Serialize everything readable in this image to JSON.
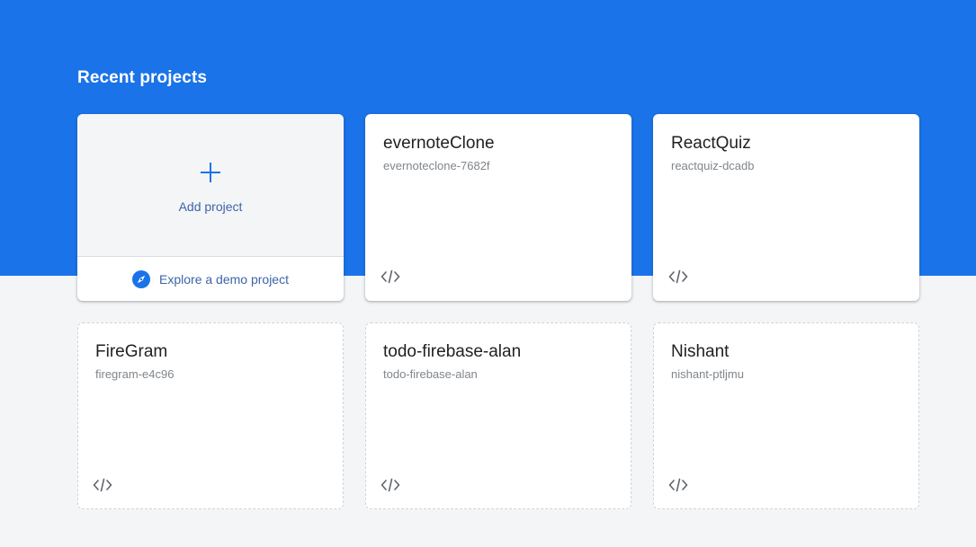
{
  "header": {
    "title": "Recent projects"
  },
  "add_card": {
    "add_label": "Add project",
    "demo_label": "Explore a demo project",
    "plus_icon": "plus-icon",
    "demo_icon": "compass-icon"
  },
  "projects": [
    {
      "name": "evernoteClone",
      "id": "evernoteclone-7682f",
      "icon": "code-icon"
    },
    {
      "name": "ReactQuiz",
      "id": "reactquiz-dcadb",
      "icon": "code-icon"
    },
    {
      "name": "FireGram",
      "id": "firegram-e4c96",
      "icon": "code-icon"
    },
    {
      "name": "todo-firebase-alan",
      "id": "todo-firebase-alan",
      "icon": "code-icon"
    },
    {
      "name": "Nishant",
      "id": "nishant-ptljmu",
      "icon": "code-icon"
    }
  ],
  "colors": {
    "band": "#1a73e8",
    "page_background": "#f4f5f7",
    "accent_text": "#3c64a8",
    "plus_icon": "#1a73e8",
    "compass_icon": "#1a73e8"
  }
}
